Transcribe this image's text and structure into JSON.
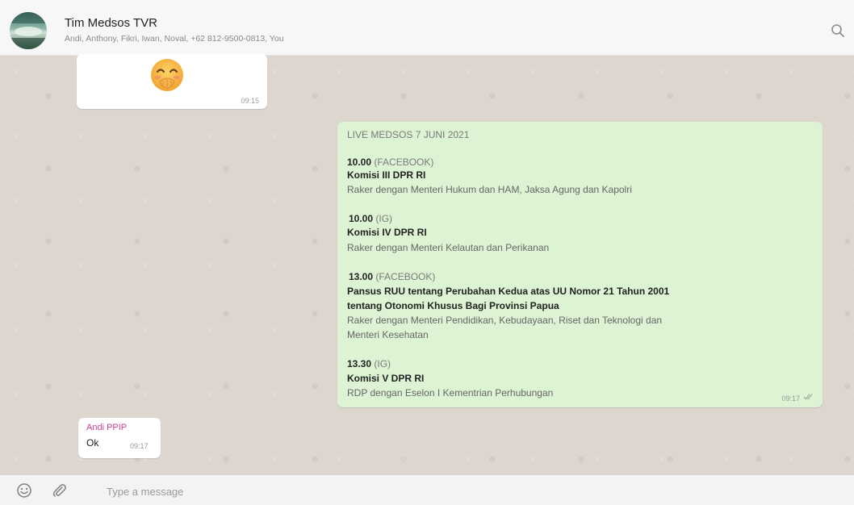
{
  "header": {
    "title": "Tim Medsos TVR",
    "members": "Andi, Anthony, Fikri, Iwan, Noval, +62 812-9500-0813, You",
    "icons": {
      "avatar": "group-avatar",
      "search": "search-icon"
    }
  },
  "messages": {
    "sticker": {
      "emoji": "hand-over-mouth-emoji",
      "time": "09:15"
    },
    "schedule": {
      "header": "LIVE MEDSOS 7 JUNI 2021",
      "items": [
        {
          "time": "10.00",
          "platform": "(FACEBOOK)",
          "title": "Komisi III DPR RI",
          "title_line2": "",
          "desc": "Raker dengan Menteri Hukum dan HAM, Jaksa Agung dan Kapolri",
          "desc_line2": ""
        },
        {
          "time": "10.00",
          "platform": "(IG)",
          "title": "Komisi IV DPR RI",
          "title_line2": "",
          "desc": "Raker dengan Menteri Kelautan dan Perikanan",
          "desc_line2": ""
        },
        {
          "time": "13.00",
          "platform": "(FACEBOOK)",
          "title": "Pansus RUU tentang Perubahan Kedua atas UU Nomor 21 Tahun 2001",
          "title_line2": "tentang Otonomi Khusus Bagi Provinsi Papua",
          "desc": "Raker dengan Menteri Pendidikan, Kebudayaan, Riset dan Teknologi dan",
          "desc_line2": "Menteri Kesehatan"
        },
        {
          "time": "13.30",
          "platform": "(IG)",
          "title": "Komisi V DPR RI",
          "title_line2": "",
          "desc": "RDP dengan Eselon I Kementrian Perhubungan",
          "desc_line2": ""
        }
      ],
      "sent_time": "09:17",
      "status_icon": "double-check-icon"
    },
    "reply": {
      "sender": "Andi PPIP",
      "text": "Ok",
      "time": "09:17"
    }
  },
  "composer": {
    "placeholder": "Type a message",
    "icons": {
      "emoji": "emoji-icon",
      "attach": "paperclip-icon"
    }
  },
  "colors": {
    "chat_background": "#dcd6cf",
    "outgoing_bubble": "#dcf4d3",
    "sender_name": "#cf3f8f"
  }
}
